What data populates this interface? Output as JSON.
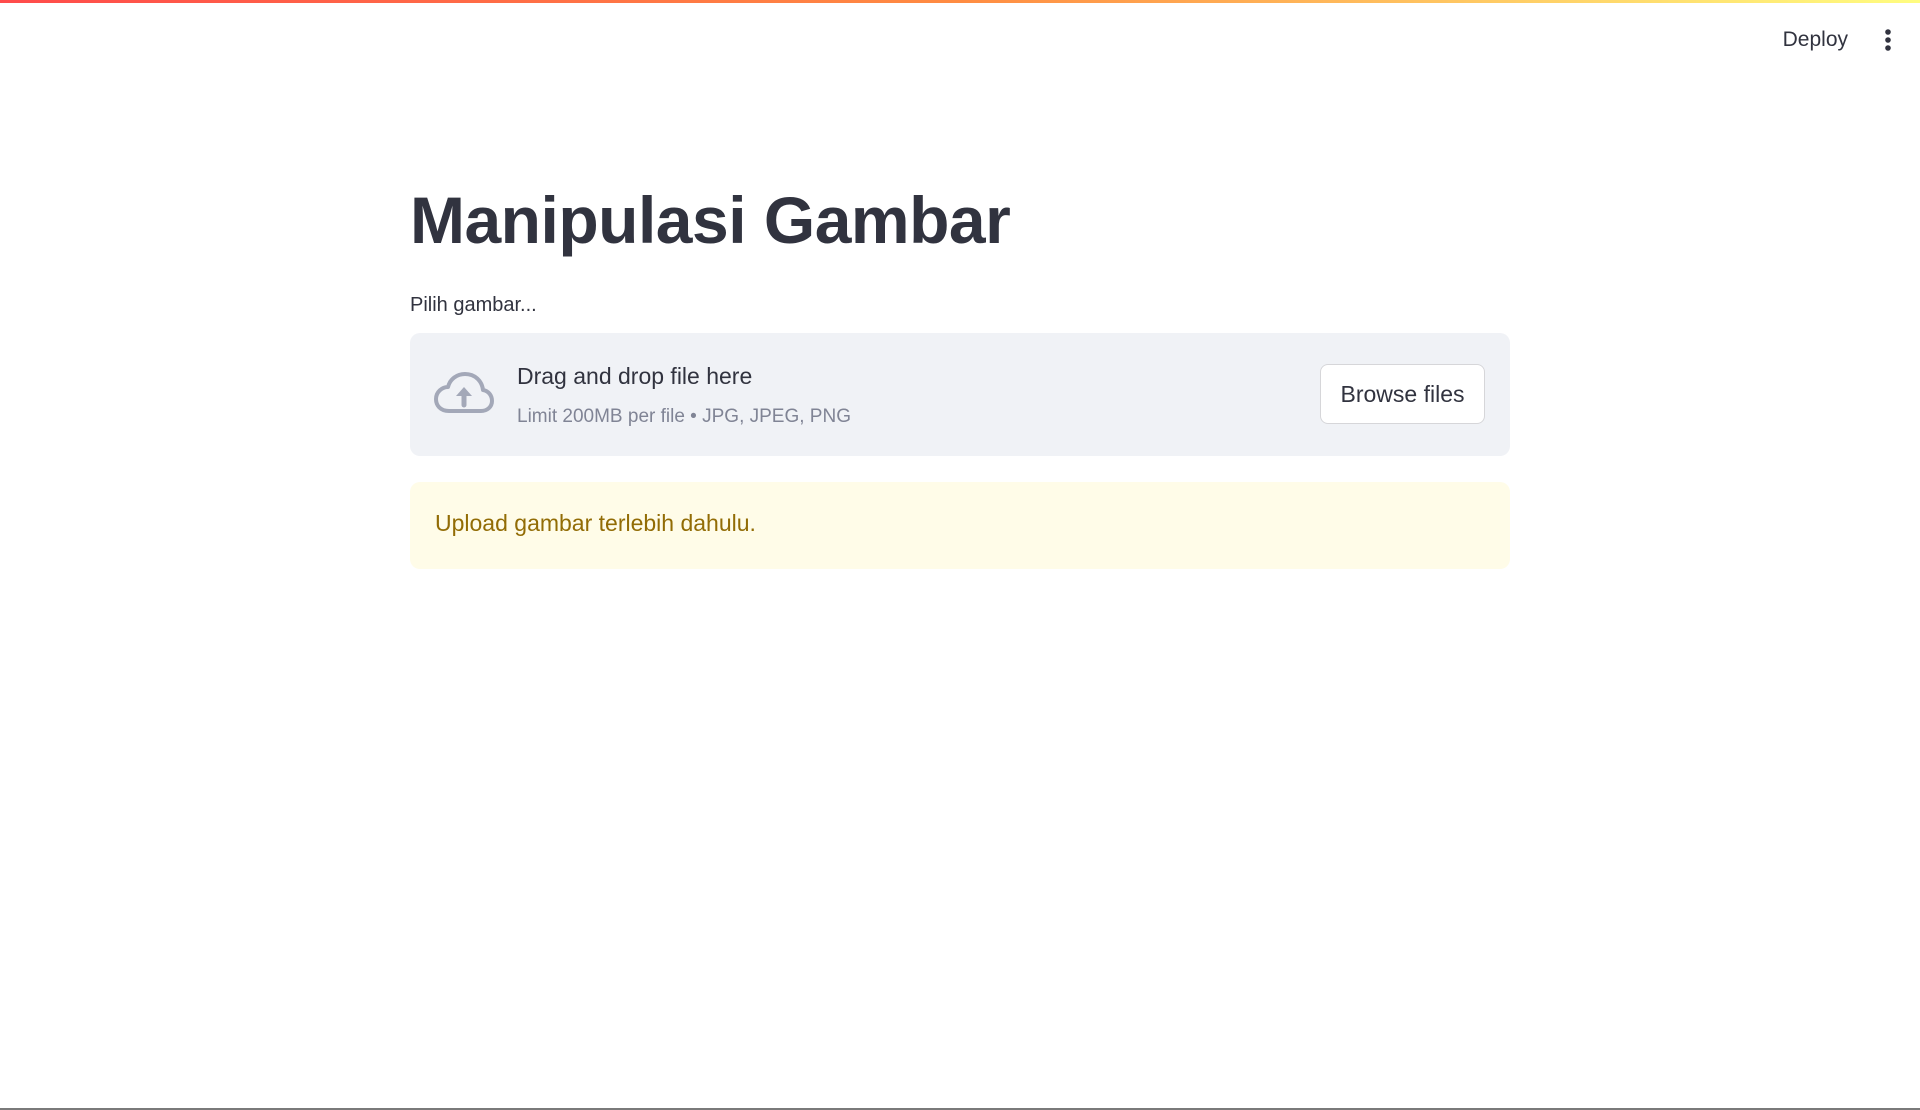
{
  "header": {
    "deploy_label": "Deploy",
    "menu_icon": "kebab-vertical-icon"
  },
  "main": {
    "title": "Manipulasi Gambar",
    "uploader": {
      "label": "Pilih gambar...",
      "icon": "cloud-upload-icon",
      "drop_text": "Drag and drop file here",
      "limit_text": "Limit 200MB per file • JPG, JPEG, PNG",
      "browse_label": "Browse files"
    },
    "warning": {
      "text": "Upload gambar terlebih dahulu."
    }
  },
  "colors": {
    "accent": "#ff4b4b",
    "warning_bg": "#fffce8",
    "warning_text": "#926c05",
    "dropzone_bg": "#f0f2f6"
  }
}
